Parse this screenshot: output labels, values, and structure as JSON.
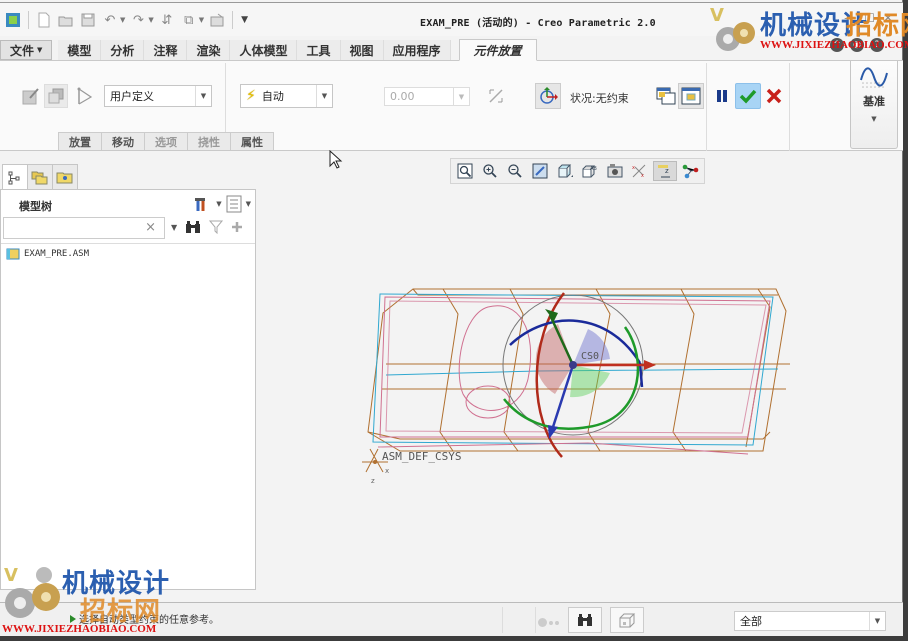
{
  "window": {
    "title": "EXAM_PRE (活动的) - Creo Parametric 2.0"
  },
  "quick_access": {
    "icons": [
      "app-icon",
      "new-icon",
      "open-icon",
      "save-icon",
      "undo-icon",
      "redo-icon",
      "regenerate-icon",
      "windows-icon",
      "close-window-icon",
      "customize-icon"
    ]
  },
  "tabs": [
    {
      "label": "文件",
      "has_dropdown": true
    },
    {
      "label": "模型"
    },
    {
      "label": "分析"
    },
    {
      "label": "注释"
    },
    {
      "label": "渲染"
    },
    {
      "label": "人体模型"
    },
    {
      "label": "工具"
    },
    {
      "label": "视图"
    },
    {
      "label": "应用程序"
    },
    {
      "label": "元件放置",
      "active": true
    }
  ],
  "ribbon": {
    "constraint_set": {
      "value": "用户定义"
    },
    "constraint_type": {
      "value": "自动"
    },
    "offset": {
      "value": "0.00"
    },
    "status": "状况:无约束",
    "datum": {
      "label": "基准"
    },
    "subtabs": [
      {
        "label": "放置",
        "enabled": true
      },
      {
        "label": "移动",
        "enabled": true
      },
      {
        "label": "选项",
        "enabled": false
      },
      {
        "label": "挠性",
        "enabled": false
      },
      {
        "label": "属性",
        "enabled": true
      }
    ]
  },
  "graphics_toolbar": {
    "icons": [
      "refit-icon",
      "zoom-in-icon",
      "zoom-out-icon",
      "repaint-icon",
      "display-style-icon",
      "saved-views-icon",
      "view-manager-icon",
      "datum-display-icon",
      "spin-center-icon",
      "annotation-display-icon"
    ]
  },
  "model_tree": {
    "title": "模型树",
    "search": {
      "value": "",
      "placeholder": ""
    },
    "items": [
      {
        "label": "EXAM_PRE.ASM"
      }
    ]
  },
  "viewport": {
    "csys_label": "CS0",
    "default_csys_label": "ASM_DEF_CSYS",
    "axis_x": "x",
    "axis_z": "z"
  },
  "status_bar": {
    "message": "选择自动类型约束的任意参考。",
    "filter": {
      "value": "全部"
    }
  },
  "watermark": {
    "brand_cn_1": "机械设计",
    "brand_cn_2": "招标网",
    "url": "WWW.JIXIEZHAOBIAO.COM"
  },
  "colors": {
    "accept_green": "#1e9a2a",
    "cancel_red": "#c8201a",
    "pause_blue": "#1a3a8a",
    "wire_orange": "#b07030",
    "wire_cyan": "#30a8d0",
    "wire_pink": "#d07090"
  }
}
